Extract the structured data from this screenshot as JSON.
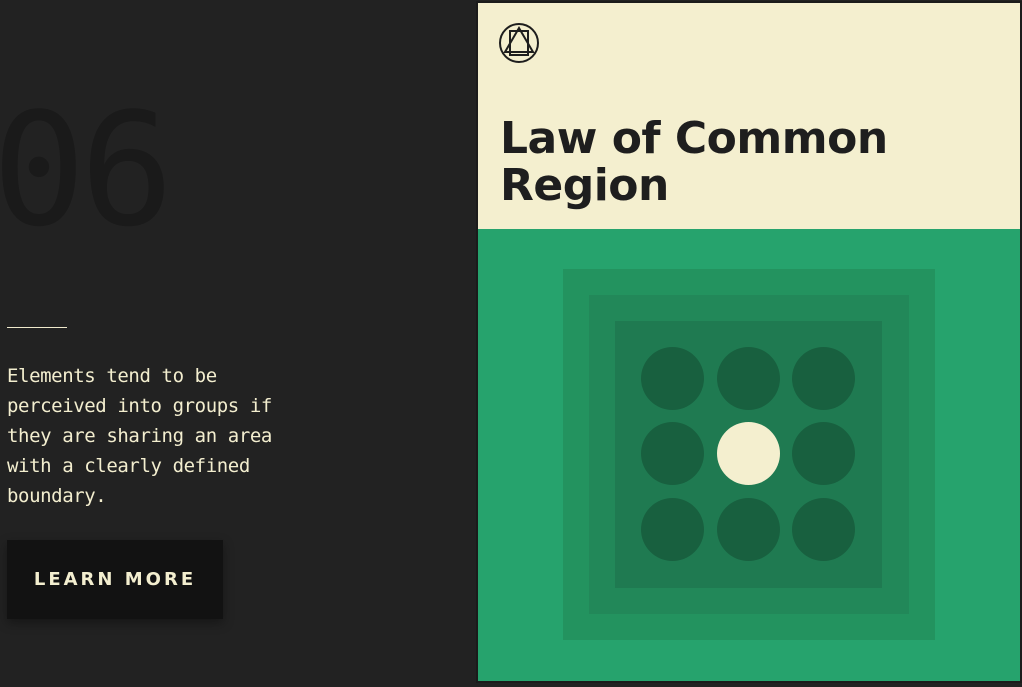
{
  "slide": {
    "number": "06",
    "description": "Elements tend to be perceived into groups if they are sharing an area with a clearly defined boundary.",
    "cta_label": "LEARN MORE"
  },
  "card": {
    "logo_icon": "triangle-in-circle-icon",
    "title_line1": "Law of Common",
    "title_line2": "Region",
    "colors": {
      "header_bg": "#f4efcf",
      "body_bg": "#26a36d",
      "region_outer": "#23935f",
      "region_mid": "#228859",
      "region_inner": "#1f7a51",
      "dot": "#18603f",
      "dot_highlight": "#f4efcf"
    },
    "grid": {
      "rows": 3,
      "cols": 3,
      "highlighted_index": 4
    }
  },
  "theme": {
    "page_bg": "#222222",
    "text_light": "#f3eecf",
    "button_bg": "#121212"
  }
}
